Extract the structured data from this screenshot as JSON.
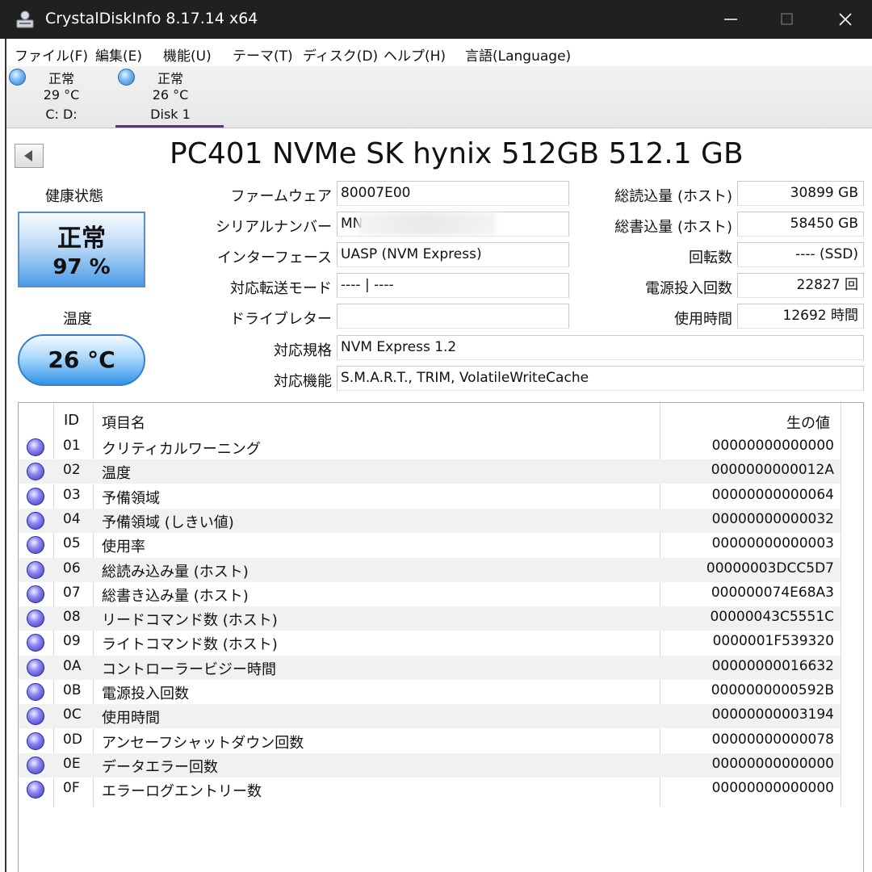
{
  "window": {
    "title": "CrystalDiskInfo 8.17.14 x64"
  },
  "menu": [
    "ファイル(F)",
    "編集(E)",
    "機能(U)",
    "テーマ(T)",
    "ディスク(D)",
    "ヘルプ(H)",
    "言語(Language)"
  ],
  "disks": [
    {
      "status": "正常",
      "temp": "29 °C",
      "label": "C: D:"
    },
    {
      "status": "正常",
      "temp": "26 °C",
      "label": "Disk 1"
    }
  ],
  "model": "PC401 NVMe SK hynix 512GB 512.1 GB",
  "health": {
    "label": "健康状態",
    "status": "正常",
    "percent": "97 %"
  },
  "temperature": {
    "label": "温度",
    "value": "26 °C"
  },
  "info_left": [
    {
      "label": "ファームウェア",
      "value": "80007E00"
    },
    {
      "label": "シリアルナンバー",
      "value": "MN                              N"
    },
    {
      "label": "インターフェース",
      "value": "UASP (NVM Express)"
    },
    {
      "label": "対応転送モード",
      "value": "---- | ----"
    },
    {
      "label": "ドライブレター",
      "value": ""
    }
  ],
  "info_right": [
    {
      "label": "総読込量 (ホスト)",
      "value": "30899 GB"
    },
    {
      "label": "総書込量 (ホスト)",
      "value": "58450 GB"
    },
    {
      "label": "回転数",
      "value": "---- (SSD)"
    },
    {
      "label": "電源投入回数",
      "value": "22827 回"
    },
    {
      "label": "使用時間",
      "value": "12692 時間"
    }
  ],
  "standard": {
    "label": "対応規格",
    "value": "NVM Express 1.2"
  },
  "features": {
    "label": "対応機能",
    "value": "S.M.A.R.T., TRIM, VolatileWriteCache"
  },
  "table": {
    "headers": {
      "id": "ID",
      "name": "項目名",
      "raw": "生の値"
    },
    "rows": [
      {
        "id": "01",
        "name": "クリティカルワーニング",
        "raw": "00000000000000"
      },
      {
        "id": "02",
        "name": "温度",
        "raw": "0000000000012A"
      },
      {
        "id": "03",
        "name": "予備領域",
        "raw": "00000000000064"
      },
      {
        "id": "04",
        "name": "予備領域 (しきい値)",
        "raw": "00000000000032"
      },
      {
        "id": "05",
        "name": "使用率",
        "raw": "00000000000003"
      },
      {
        "id": "06",
        "name": "総読み込み量 (ホスト)",
        "raw": "00000003DCC5D7"
      },
      {
        "id": "07",
        "name": "総書き込み量 (ホスト)",
        "raw": "000000074E68A3"
      },
      {
        "id": "08",
        "name": "リードコマンド数 (ホスト)",
        "raw": "00000043C5551C"
      },
      {
        "id": "09",
        "name": "ライトコマンド数 (ホスト)",
        "raw": "0000001F539320"
      },
      {
        "id": "0A",
        "name": "コントローラービジー時間",
        "raw": "00000000016632"
      },
      {
        "id": "0B",
        "name": "電源投入回数",
        "raw": "0000000000592B"
      },
      {
        "id": "0C",
        "name": "使用時間",
        "raw": "00000000003194"
      },
      {
        "id": "0D",
        "name": "アンセーフシャットダウン回数",
        "raw": "00000000000078"
      },
      {
        "id": "0E",
        "name": "データエラー回数",
        "raw": "00000000000000"
      },
      {
        "id": "0F",
        "name": "エラーログエントリー数",
        "raw": "00000000000000"
      }
    ]
  }
}
